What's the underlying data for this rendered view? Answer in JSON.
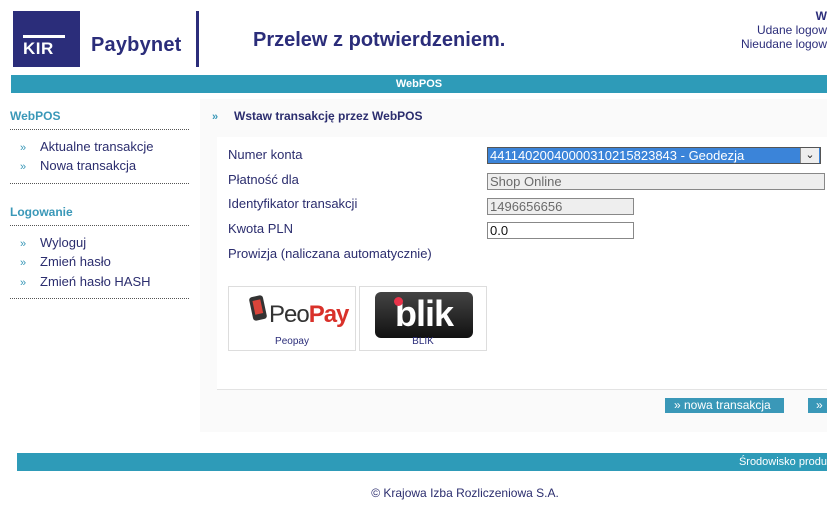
{
  "header": {
    "logo_text": "KIR",
    "brand": "Paybynet",
    "title": "Przelew z potwierdzeniem.",
    "user_info": {
      "welcome_truncated": "W",
      "successful_logins_label": "Udane logow",
      "failed_logins_label": "Nieudane logow"
    }
  },
  "top_band": {
    "label": "WebPOS"
  },
  "sidebar": {
    "sections": [
      {
        "heading": "WebPOS",
        "items": [
          {
            "label": "Aktualne transakcje"
          },
          {
            "label": "Nowa transakcja"
          }
        ]
      },
      {
        "heading": "Logowanie",
        "items": [
          {
            "label": "Wyloguj"
          },
          {
            "label": "Zmień hasło"
          },
          {
            "label": "Zmień hasło HASH"
          }
        ]
      }
    ],
    "bullet": "»"
  },
  "main": {
    "section_title": "Wstaw transakcję przez WebPOS",
    "bullet": "»",
    "form": {
      "account_label": "Numer konta",
      "account_value": "44114020040000310215823843 - Geodezja",
      "payee_label": "Płatność dla",
      "payee_value": "Shop Online",
      "txid_label": "Identyfikator transakcji",
      "txid_value": "1496656656",
      "amount_label": "Kwota PLN",
      "amount_value": "0.0",
      "fee_label": "Prowizja (naliczana automatycznie)"
    },
    "payment_methods": [
      {
        "name": "PeoPay",
        "name_a": "Peo",
        "name_b": "Pay",
        "caption": "Peopay"
      },
      {
        "name": "blik",
        "caption": "BLIK"
      }
    ],
    "buttons": {
      "new_transaction": "» nowa transakcja",
      "next_truncated": "» "
    }
  },
  "footer": {
    "band_label": "Środowisko produ",
    "copyright": "© Krajowa Izba Rozliczeniowa S.A."
  },
  "colors": {
    "brand_navy": "#2b2d7a",
    "accent_teal": "#2e9bb8",
    "select_highlight": "#3b84d9"
  }
}
